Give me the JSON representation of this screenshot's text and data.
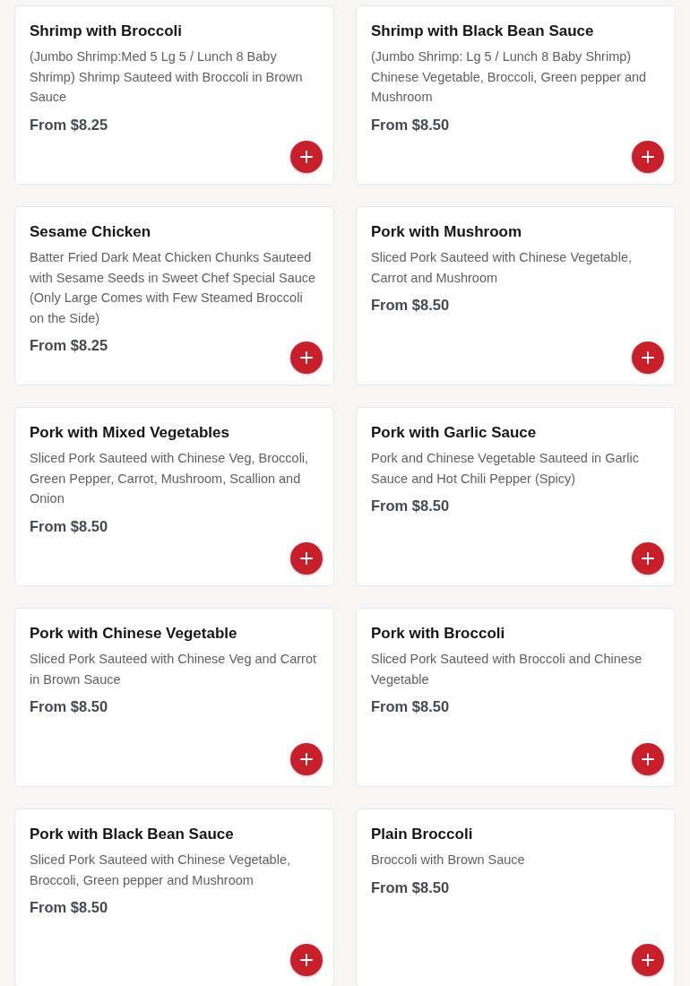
{
  "menu_items": [
    {
      "name": "Shrimp with Broccoli",
      "description": "(Jumbo Shrimp:Med 5 Lg 5 / Lunch 8 Baby Shrimp) Shrimp Sauteed with Broccoli in Brown Sauce",
      "price": "From $8.25"
    },
    {
      "name": "Shrimp with Black Bean Sauce",
      "description": "(Jumbo Shrimp: Lg 5 / Lunch 8 Baby Shrimp) Chinese Vegetable, Broccoli, Green pepper and Mushroom",
      "price": "From $8.50"
    },
    {
      "name": "Sesame Chicken",
      "description": "Batter Fried Dark Meat Chicken Chunks Sauteed with Sesame Seeds in Sweet Chef Special Sauce (Only Large Comes with Few Steamed Broccoli on the Side)",
      "price": "From $8.25"
    },
    {
      "name": "Pork with Mushroom",
      "description": "Sliced Pork Sauteed with Chinese Vegetable, Carrot and Mushroom",
      "price": "From $8.50"
    },
    {
      "name": "Pork with Mixed Vegetables",
      "description": "Sliced Pork Sauteed with Chinese Veg, Broccoli, Green Pepper, Carrot, Mushroom, Scallion and Onion",
      "price": "From $8.50"
    },
    {
      "name": "Pork with Garlic Sauce",
      "description": "Pork and Chinese Vegetable Sauteed in Garlic Sauce and Hot Chili Pepper (Spicy)",
      "price": "From $8.50"
    },
    {
      "name": "Pork with Chinese Vegetable",
      "description": "Sliced Pork Sauteed with Chinese Veg and Carrot in Brown Sauce",
      "price": "From $8.50"
    },
    {
      "name": "Pork with Broccoli",
      "description": "Sliced Pork Sauteed with Broccoli and Chinese Vegetable",
      "price": "From $8.50"
    },
    {
      "name": "Pork with Black Bean Sauce",
      "description": "Sliced Pork Sauteed with Chinese Vegetable, Broccoli, Green pepper and Mushroom",
      "price": "From $8.50"
    },
    {
      "name": "Plain Broccoli",
      "description": "Broccoli with Brown Sauce",
      "price": "From $8.50"
    }
  ]
}
